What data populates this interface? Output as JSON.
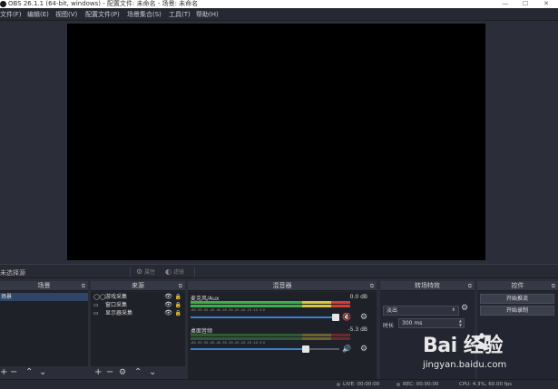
{
  "window": {
    "title": "OBS 26.1.1 (64-bit, windows) - 配置文件: 未命名 - 场景: 未命名",
    "controls": [
      "—",
      "☐",
      "✕"
    ]
  },
  "menu": [
    "文件(F)",
    "编辑(E)",
    "视图(V)",
    "配置文件(P)",
    "场景集合(S)",
    "工具(T)",
    "帮助(H)"
  ],
  "context_bar": {
    "no_source": "未选择源",
    "properties": "属性",
    "filters": "滤镜"
  },
  "scenes": {
    "title": "场景",
    "items": [
      "场景"
    ]
  },
  "sources": {
    "title": "来源",
    "items": [
      {
        "label": "游戏采集",
        "icon": "game-capture-icon"
      },
      {
        "label": "窗口采集",
        "icon": "window-capture-icon"
      },
      {
        "label": "显示器采集",
        "icon": "display-capture-icon"
      }
    ]
  },
  "mixer": {
    "title": "混音器",
    "ticks": "-60 -55 -50 -45 -40 -35 -30 -25 -20 -15 -10 -5 0",
    "channels": [
      {
        "name": "麦克风/Aux",
        "db": "0.0 dB",
        "level": 1.0,
        "volume": 1.0,
        "muted": true
      },
      {
        "name": "桌面音频",
        "db": "-5.3 dB",
        "level": 0.0,
        "volume": 0.8,
        "muted": false
      }
    ]
  },
  "transitions": {
    "title": "转场特效",
    "selected": "淡出",
    "duration_label": "时长",
    "duration_value": "300 ms"
  },
  "controls": {
    "title": "控件",
    "start_stream": "开始推流",
    "start_record": "开始录制"
  },
  "status": {
    "live": "LIVE: 00:00:00",
    "rec": "REC: 00:00:00",
    "cpu": "CPU: 4.3%, 60.00 fps"
  },
  "watermark": {
    "logo": "Bai  经验",
    "url": "jingyan.baidu.com"
  },
  "colors": {
    "accent": "#3d7fc8",
    "selection": "#2f4566",
    "muted_icon": "#d03030"
  }
}
